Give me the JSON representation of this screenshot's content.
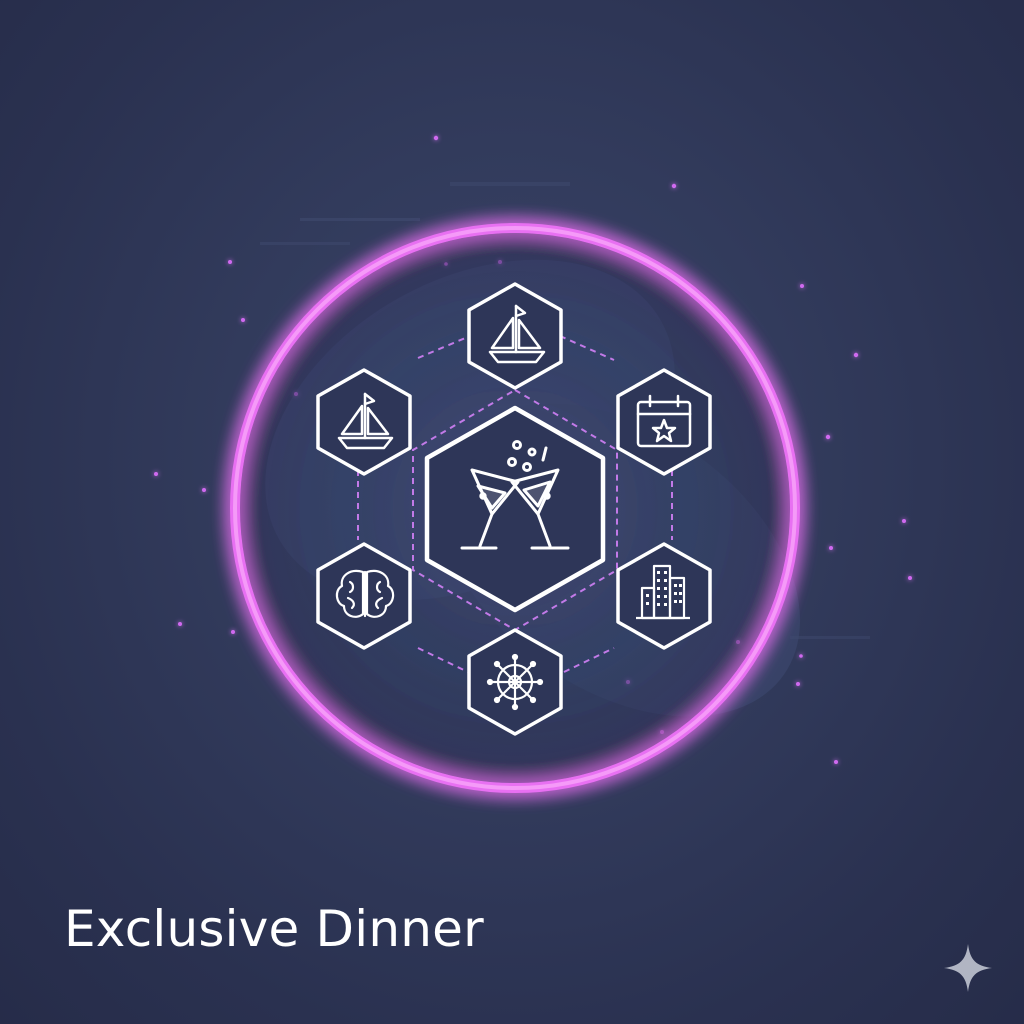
{
  "title": "Exclusive Dinner",
  "colors": {
    "background": "#2f3656",
    "ring": "#e86ff0",
    "accent": "#c98af0",
    "icon_stroke": "#ffffff"
  },
  "center_icon": "cocktail-glasses-icon",
  "satellite_icons": [
    "sailboat-icon",
    "calendar-star-icon",
    "city-buildings-icon",
    "ship-wheel-icon",
    "brain-icon",
    "sailboat-icon"
  ],
  "corner_icon": "sparkle-icon"
}
